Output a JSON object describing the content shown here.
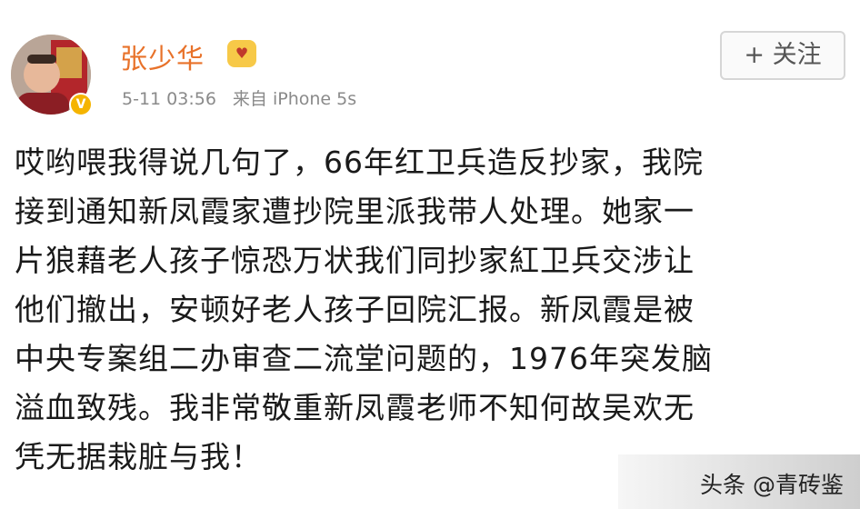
{
  "post": {
    "username": "张少华",
    "level_icon": "vip-level-icon",
    "verified_icon": "verified-v-icon",
    "timestamp": "5-11 03:56",
    "source": "来自 iPhone 5s",
    "follow_label": "+ 关注",
    "body": "哎哟喂我得说几句了，66年红卫兵造反抄家，我院\n接到通知新凤霞家遭抄院里派我带人处理。她家一\n片狼藉老人孩子惊恐万状我们同抄家紅卫兵交涉让\n他们撤出，安顿好老人孩子回院汇报。新凤霞是被\n中央专案组二办审查二流堂问题的，1976年突发脑\n溢血致残。我非常敬重新凤霞老师不知何故吴欢无\n凭无据栽脏与我！"
  },
  "watermark": {
    "text": "头条 @青砖鉴"
  },
  "colors": {
    "username": "#e8722a",
    "meta": "#8a8a8a",
    "badge": "#f5b400"
  }
}
